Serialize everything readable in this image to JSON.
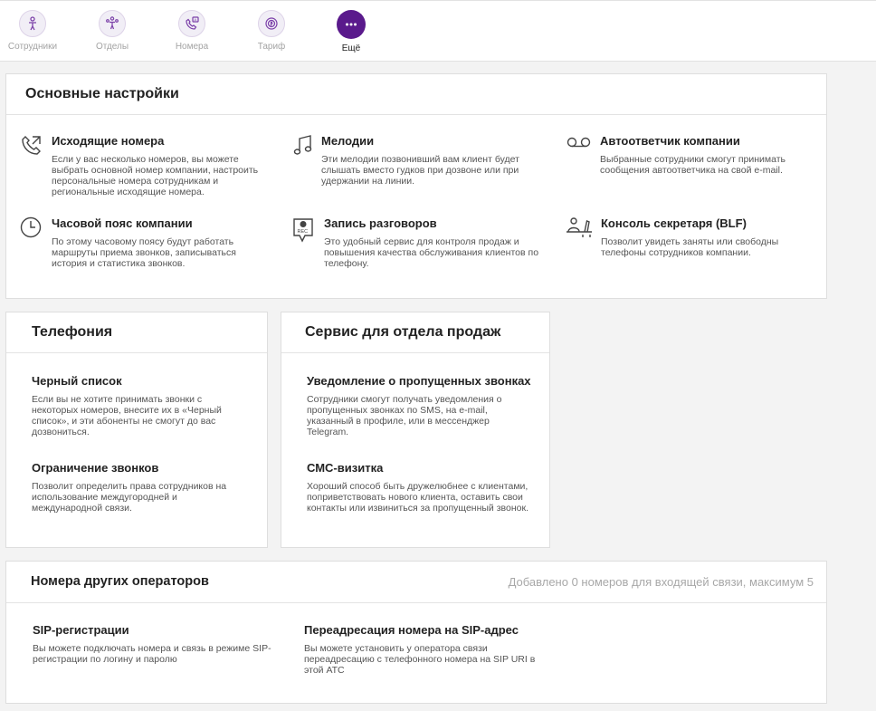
{
  "nav": {
    "items": [
      {
        "label": "Сотрудники",
        "icon": "employee-icon"
      },
      {
        "label": "Отделы",
        "icon": "departments-icon"
      },
      {
        "label": "Номера",
        "icon": "phone-numbers-icon"
      },
      {
        "label": "Тариф",
        "icon": "tariff-icon"
      },
      {
        "label": "Ещё",
        "icon": "more-dots-icon"
      }
    ],
    "active_index": 4,
    "accent_color": "#5a1a8c"
  },
  "basic_settings": {
    "title": "Основные настройки",
    "items": [
      {
        "title": "Исходящие номера",
        "icon": "outgoing-call-icon",
        "desc": "Если у вас несколько номеров, вы можете выбрать основной номер компании, настроить персональные номера сотрудникам и региональные исходящие номера."
      },
      {
        "title": "Мелодии",
        "icon": "music-note-icon",
        "desc": "Эти мелодии позвонивший вам клиент будет слышать вместо гудков при дозвоне или при удержании на линии."
      },
      {
        "title": "Автоответчик компании",
        "icon": "voicemail-icon",
        "desc": "Выбранные сотрудники смогут принимать сообщения автоответчика на свой e-mail."
      },
      {
        "title": "Часовой пояс компании",
        "icon": "clock-icon",
        "desc": "По этому часовому поясу будут работать маршруты приема звонков, записываться история и статистика звонков."
      },
      {
        "title": "Запись разговоров",
        "icon": "rec-icon",
        "desc": "Это удобный сервис для контроля продаж и повышения качества обслуживания клиентов по телефону."
      },
      {
        "title": "Консоль секретаря (BLF)",
        "icon": "secretary-console-icon",
        "desc": "Позволит увидеть заняты или свободны телефоны сотрудников компании."
      }
    ]
  },
  "telephony": {
    "title": "Телефония",
    "items": [
      {
        "title": "Черный список",
        "desc": "Если вы не хотите принимать звонки с некоторых номеров, внесите их в «Черный список», и эти абоненты не смогут до вас дозвониться."
      },
      {
        "title": "Ограничение звонков",
        "desc": "Позволит определить права сотрудников на использование междугородней и международной связи."
      }
    ]
  },
  "sales": {
    "title": "Сервис для отдела продаж",
    "items": [
      {
        "title": "Уведомление о пропущенных звонках",
        "desc": "Сотрудники смогут получать уведомления о пропущенных звонках по SMS, на e-mail, указанный в профиле, или в мессенджер Telegram."
      },
      {
        "title": "СМС-визитка",
        "desc": "Хороший способ быть дружелюбнее с клиентами, поприветствовать нового клиента, оставить свои контакты или извиниться за пропущенный звонок."
      }
    ]
  },
  "operators": {
    "title": "Номера других операторов",
    "note": "Добавлено 0 номеров для входящей связи, максимум 5",
    "items": [
      {
        "title": "SIP-регистрации",
        "desc": "Вы можете подключать номера и связь в режиме SIP-регистрации по логину и паролю"
      },
      {
        "title": "Переадресация номера на SIP-адрес",
        "desc": "Вы можете установить у оператора связи переадресацию с телефонного номера на SIP URI в этой АТС"
      }
    ]
  }
}
